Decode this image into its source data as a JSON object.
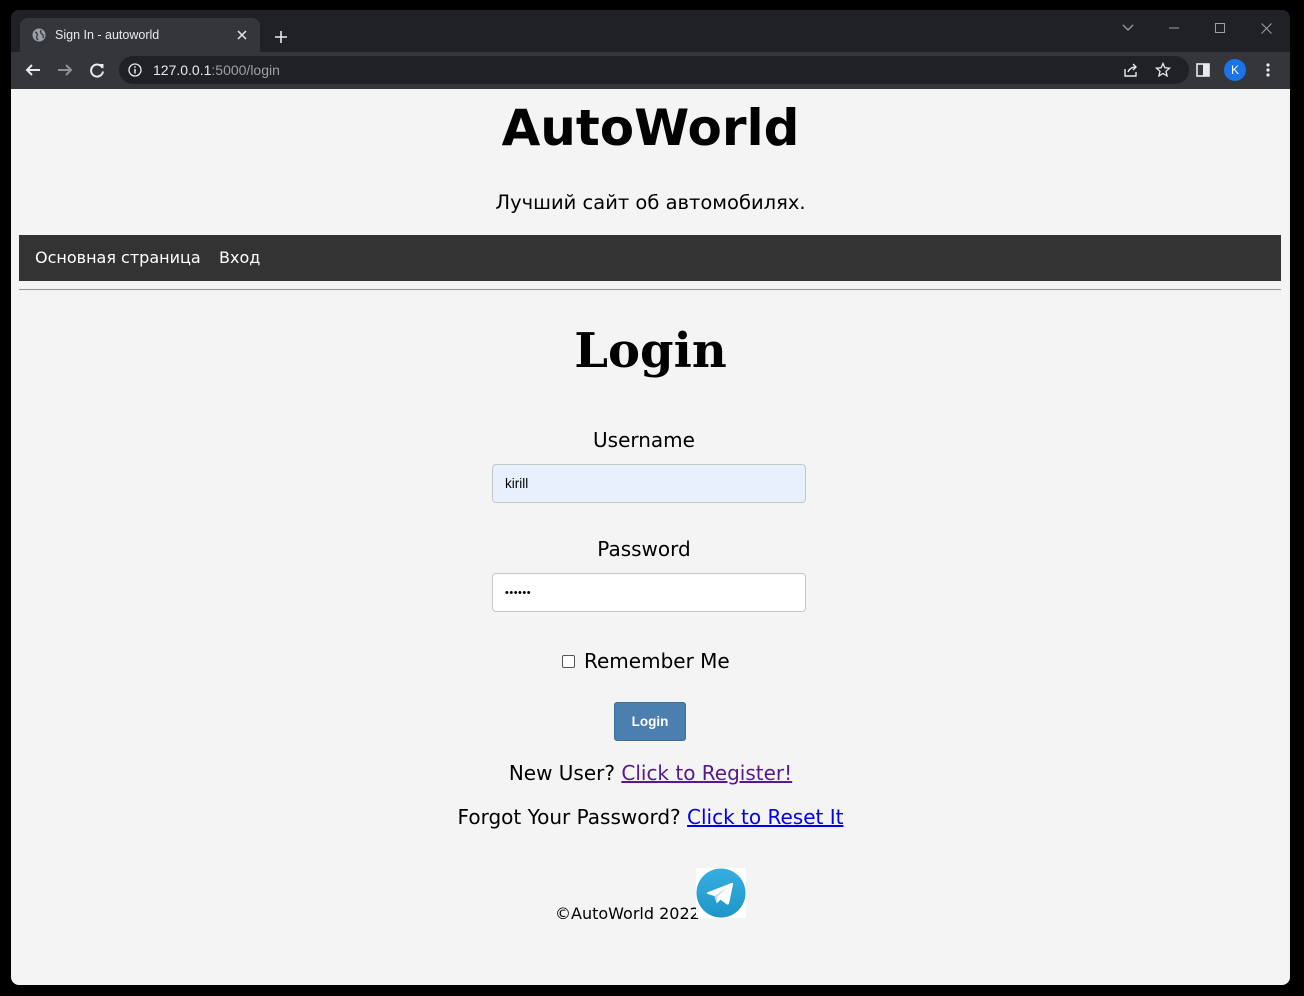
{
  "browser": {
    "tab_title": "Sign In - autoworld",
    "url_host": "127.0.0.1",
    "url_rest": ":5000/login",
    "profile_initial": "K"
  },
  "header": {
    "site_title": "AutoWorld",
    "tagline": "Лучший сайт об автомобилях."
  },
  "nav": {
    "items": [
      {
        "label": "Основная страница"
      },
      {
        "label": "Вход"
      }
    ]
  },
  "login": {
    "heading": "Login",
    "username_label": "Username",
    "username_value": "kirill",
    "password_label": "Password",
    "password_value": "••••••",
    "remember_label": "Remember Me",
    "remember_checked": false,
    "submit_label": "Login",
    "new_user_text": "New User?",
    "register_link": "Click to Register!",
    "forgot_text": "Forgot Your Password?",
    "reset_link": "Click to Reset It"
  },
  "footer": {
    "copyright": "©AutoWorld 2022",
    "social_icon": "telegram-icon"
  },
  "colors": {
    "page_bg": "#f4f4f4",
    "navbar_bg": "#333333",
    "button_bg": "#4a7fb0",
    "autofill_bg": "#e8f0fe",
    "visited_link": "#551a8b",
    "link": "#0000ee"
  }
}
